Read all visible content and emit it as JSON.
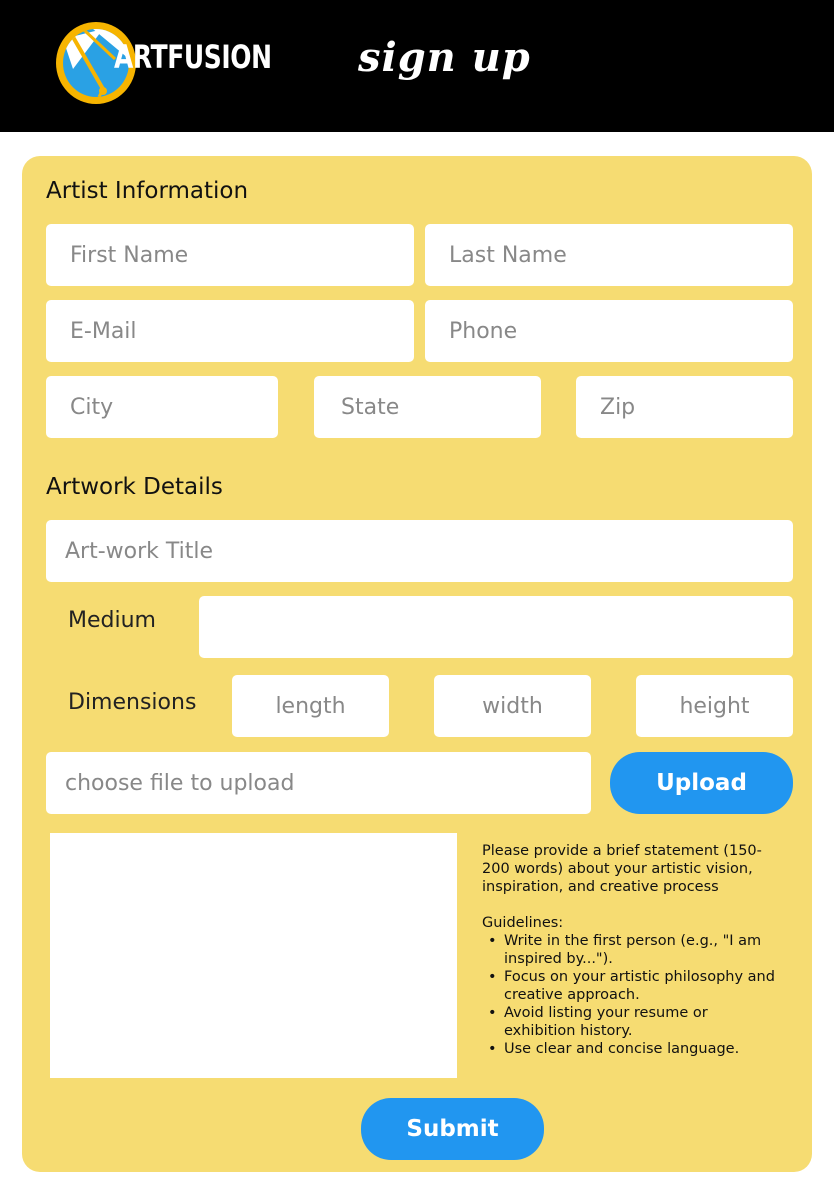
{
  "header": {
    "logo_text": "ARTFUSION",
    "page_title": "sign up"
  },
  "colors": {
    "header_bg": "#000000",
    "panel_bg": "#f6dc72",
    "button_bg": "#2196f0",
    "logo_ring": "#f6b400",
    "logo_fill": "#2aa1e4"
  },
  "artist_info": {
    "title": "Artist Information",
    "first_name_placeholder": "First Name",
    "last_name_placeholder": "Last Name",
    "email_placeholder": "E-Mail",
    "phone_placeholder": "Phone",
    "city_placeholder": "City",
    "state_placeholder": "State",
    "zip_placeholder": "Zip"
  },
  "artwork": {
    "title": "Artwork Details",
    "artwork_title_placeholder": "Art-work Title",
    "medium_label": "Medium",
    "medium_value": "",
    "dimensions_label": "Dimensions",
    "length_placeholder": "length",
    "width_placeholder": "width",
    "height_placeholder": "height",
    "file_placeholder": "choose file to upload",
    "upload_label": "Upload"
  },
  "statement": {
    "intro": "Please provide a brief statement (150-200 words) about your artistic vision, inspiration, and creative process",
    "guidelines_title": "Guidelines:",
    "guidelines": [
      "Write in the first person (e.g., \"I am inspired by...\").",
      "Focus on your artistic philosophy and creative approach.",
      "Avoid listing your resume or exhibition history.",
      "Use clear and concise language."
    ]
  },
  "submit_label": "Submit"
}
